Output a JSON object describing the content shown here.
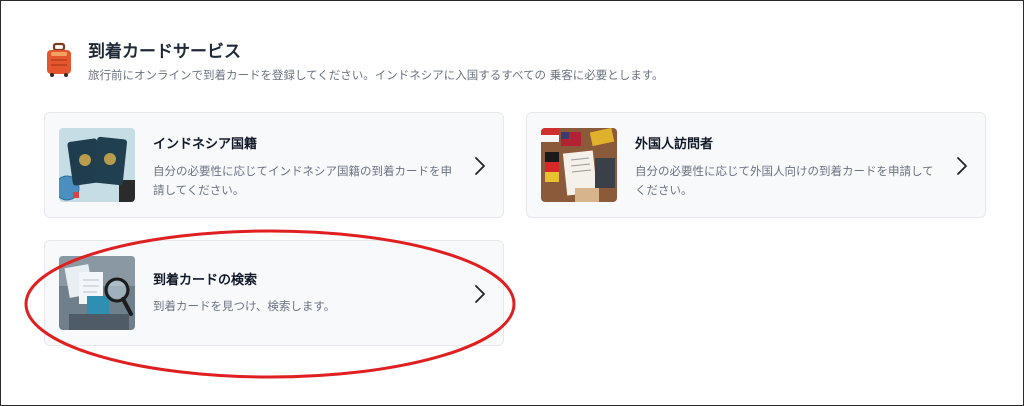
{
  "header": {
    "icon": "suitcase-icon",
    "title": "到着カードサービス",
    "subtitle": "旅行前にオンラインで到着カードを登録してください。インドネシアに入国するすべての 乗客に必要とします。"
  },
  "cards": [
    {
      "icon": "passport-thumbnail",
      "title": "インドネシア国籍",
      "description_line1": "自分の必要性に応じてインドネシア国籍の到着カードを申",
      "description_line2": "請してください。"
    },
    {
      "icon": "flags-form-thumbnail",
      "title": "外国人訪問者",
      "description_line1": "自分の必要性に応じて外国人向けの到着カードを申請して",
      "description_line2": "ください。"
    },
    {
      "icon": "magnifier-documents-thumbnail",
      "title": "到着カードの検索",
      "description_line1": "到着カードを見つけ、検索します。"
    }
  ],
  "colors": {
    "highlight": "#e02020",
    "card_background": "#f8f9fb",
    "suitcase": "#e4572e"
  }
}
